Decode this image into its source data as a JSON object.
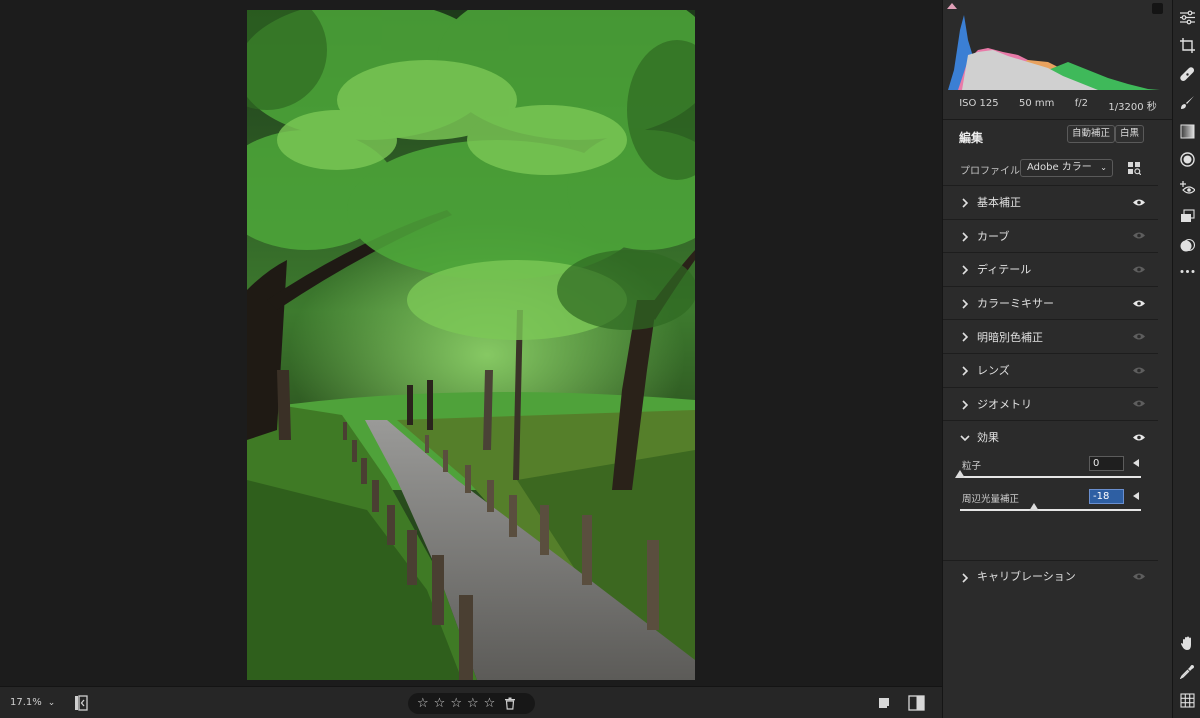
{
  "canvas": {
    "zoom": "17.1%",
    "rating_stars": [
      "☆",
      "☆",
      "☆",
      "☆",
      "☆"
    ]
  },
  "exif": {
    "iso": "ISO 125",
    "focal_length": "50 mm",
    "aperture": "f/2",
    "shutter": "1/3200 秒"
  },
  "edit": {
    "title": "編集",
    "auto_button": "自動補正",
    "bw_button": "白黒",
    "profile_label": "プロファイル",
    "profile_value": "Adobe カラー"
  },
  "sections": [
    {
      "label": "基本補正",
      "visibility": "on"
    },
    {
      "label": "カーブ",
      "visibility": "dim"
    },
    {
      "label": "ディテール",
      "visibility": "dim"
    },
    {
      "label": "カラーミキサー",
      "visibility": "on"
    },
    {
      "label": "明暗別色補正",
      "visibility": "dim"
    },
    {
      "label": "レンズ",
      "visibility": "dim"
    },
    {
      "label": "ジオメトリ",
      "visibility": "dim"
    }
  ],
  "effects": {
    "label": "効果",
    "grain_label": "粒子",
    "grain_value": "0",
    "grain_position": 0,
    "vignette_label": "周辺光量補正",
    "vignette_value": "-18",
    "vignette_position": 0.41
  },
  "calibration": {
    "label": "キャリブレーション"
  },
  "tools": [
    "edit-sliders-icon",
    "crop-icon",
    "healing-icon",
    "brush-icon",
    "linear-gradient-icon",
    "radial-gradient-icon",
    "red-eye-icon",
    "presets-icon",
    "versions-icon",
    "more-icon",
    "hand-icon",
    "eyedropper-icon",
    "grid-icon"
  ],
  "colors": {
    "panel_bg": "#2b2b2b",
    "accent": "#2e5fa3",
    "histogram_blue": "#3b7fd4",
    "histogram_pink": "#e87aa8",
    "histogram_orange": "#e8a25f",
    "histogram_green": "#3fb95a"
  }
}
